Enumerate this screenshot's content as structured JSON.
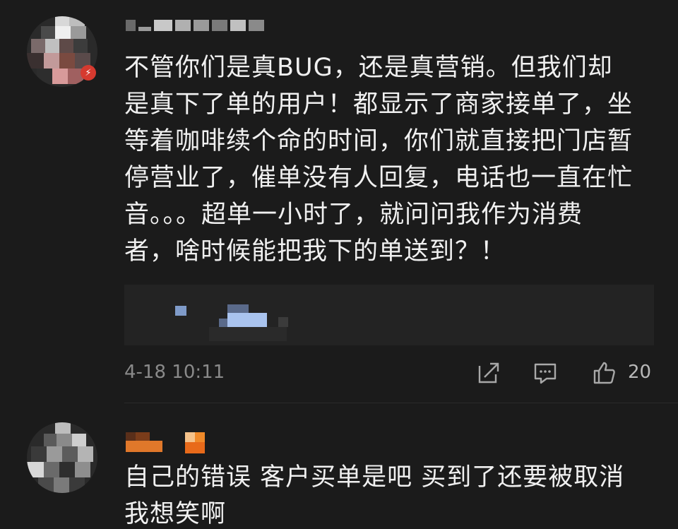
{
  "comments": [
    {
      "text": "不管你们是真BUG，还是真营销。但我们却\n是真下了单的用户！都显示了商家接单了，坐\n等着咖啡续个命的时间，你们就直接把门店暂\n停营业了，催单没有人回复，电话也一直在忙\n音。。。超单一小时了，就问问我作为消费\n者，啥时候能把我下的单送到？！",
      "timestamp": "4-18 10:11",
      "like_count": "20",
      "icons": [
        "share-icon",
        "comment-icon",
        "like-icon"
      ]
    },
    {
      "text": "自己的错误 客户买单是吧 买到了还要被取消\n我想笑啊"
    }
  ],
  "colors": {
    "background": "#1b1b1b",
    "text": "#f0f0f0",
    "meta": "#8a8a8a",
    "badge": "#d63a2f",
    "username2_orange": "#e0782a"
  }
}
